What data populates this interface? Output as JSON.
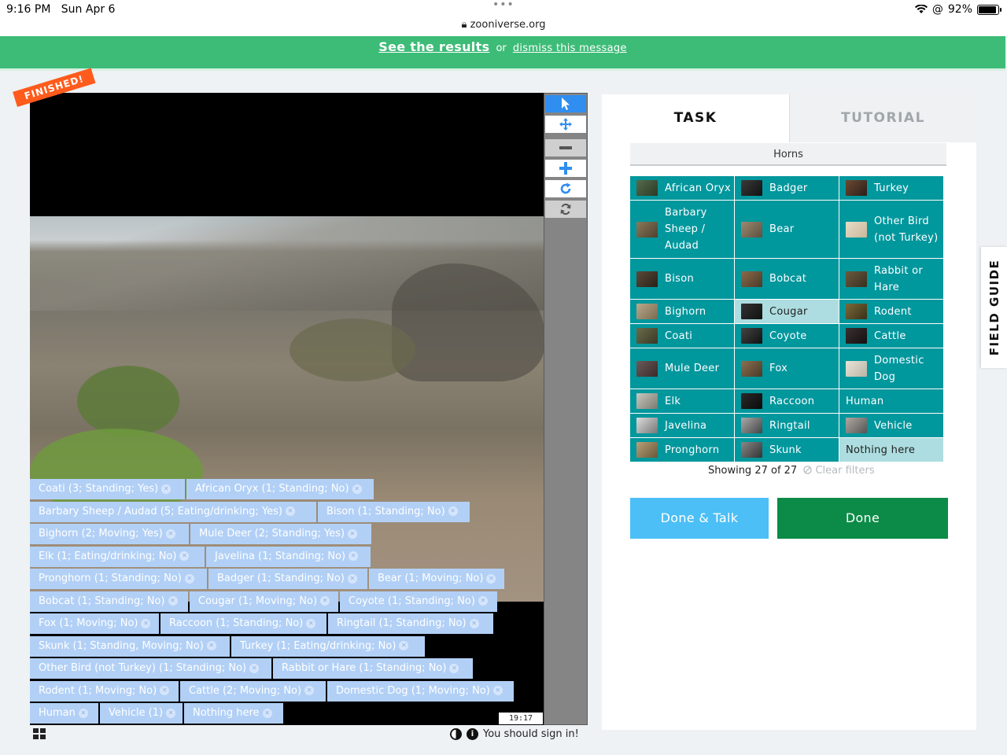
{
  "status": {
    "time": "9:16 PM",
    "date": "Sun Apr 6",
    "url": "zooniverse.org",
    "battery": "92%",
    "battery_level": 0.92
  },
  "banner": {
    "results": "See the results",
    "or": "or",
    "dismiss": "dismiss this message",
    "color": "#3dbc77"
  },
  "viewer": {
    "finished": "FINISHED!",
    "timestamp": "19:17",
    "sign_in": "You should sign in!"
  },
  "annotations": [
    [
      "Coati (3; Standing; Yes)",
      "African Oryx (1; Standing; No)"
    ],
    [
      "Barbary Sheep / Audad (5; Eating/drinking; Yes)",
      "Bison (1; Standing; No)"
    ],
    [
      "Bighorn (2; Moving; Yes)",
      "Mule Deer (2; Standing; Yes)"
    ],
    [
      "Elk (1; Eating/drinking; No)",
      "Javelina (1; Standing; No)"
    ],
    [
      "Pronghorn (1; Standing; No)",
      "Badger (1; Standing; No)",
      "Bear (1; Moving; No)"
    ],
    [
      "Bobcat (1; Standing; No)",
      "Cougar (1; Moving; No)",
      "Coyote (1; Standing; No)"
    ],
    [
      "Fox (1; Moving; No)",
      "Raccoon (1; Standing; No)",
      "Ringtail (1; Standing; No)"
    ],
    [
      "Skunk (1; Standing, Moving; No)",
      "Turkey (1; Eating/drinking; No)"
    ],
    [
      "Other Bird (not Turkey) (1; Standing; No)",
      "Rabbit or Hare (1; Standing; No)"
    ],
    [
      "Rodent (1; Moving; No)",
      "Cattle (2; Moving; No)",
      "Domestic Dog (1; Moving; No)"
    ],
    [
      "Human",
      "Vehicle (1)",
      "Nothing here"
    ]
  ],
  "panel": {
    "tab_task": "TASK",
    "tab_tutorial": "TUTORIAL",
    "filter": "Horns",
    "choices": [
      [
        "African Oryx",
        "Badger",
        "Turkey"
      ],
      [
        "Barbary Sheep / Audad",
        "Bear",
        "Other Bird (not Turkey)"
      ],
      [
        "Bison",
        "Bobcat",
        "Rabbit or Hare"
      ],
      [
        "Bighorn",
        "Cougar",
        "Rodent"
      ],
      [
        "Coati",
        "Coyote",
        "Cattle"
      ],
      [
        "Mule Deer",
        "Fox",
        "Domestic Dog"
      ],
      [
        "Elk",
        "Raccoon",
        "Human"
      ],
      [
        "Javelina",
        "Ringtail",
        "Vehicle"
      ],
      [
        "Pronghorn",
        "Skunk",
        "Nothing here"
      ]
    ],
    "highlighted": [
      "Cougar",
      "Nothing here"
    ],
    "showing": "Showing 27 of 27",
    "clear_filters": "Clear filters",
    "done_talk": "Done & Talk",
    "done": "Done",
    "field_guide": "FIELD GUIDE",
    "accent": "#00979d"
  }
}
